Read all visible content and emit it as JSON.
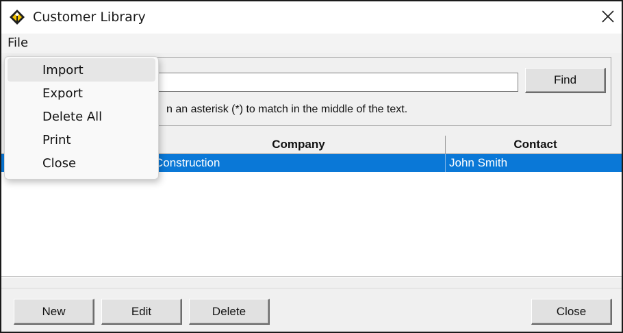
{
  "window": {
    "title": "Customer Library",
    "icon": "diamond-app-icon",
    "close_icon": "close-icon"
  },
  "menubar": {
    "file_label": "File"
  },
  "file_menu": {
    "items": [
      {
        "label": "Import",
        "highlighted": true
      },
      {
        "label": "Export",
        "highlighted": false
      },
      {
        "label": "Delete All",
        "highlighted": false
      },
      {
        "label": "Print",
        "highlighted": false
      },
      {
        "label": "Close",
        "highlighted": false
      }
    ]
  },
  "search": {
    "value": "",
    "find_label": "Find",
    "hint_visible": "n an asterisk (*) to match in the middle of the text."
  },
  "table": {
    "columns": [
      {
        "label": ""
      },
      {
        "label": "Company"
      },
      {
        "label": "Contact"
      }
    ],
    "rows": [
      {
        "cells": [
          "",
          "Construction",
          "John Smith"
        ],
        "selected": true
      }
    ]
  },
  "buttons": {
    "new_label": "New",
    "edit_label": "Edit",
    "delete_label": "Delete",
    "close_label": "Close"
  },
  "colors": {
    "selection": "#0a78d7",
    "dialog_bg": "#f0f0f0",
    "icon_gold": "#f2c200"
  }
}
